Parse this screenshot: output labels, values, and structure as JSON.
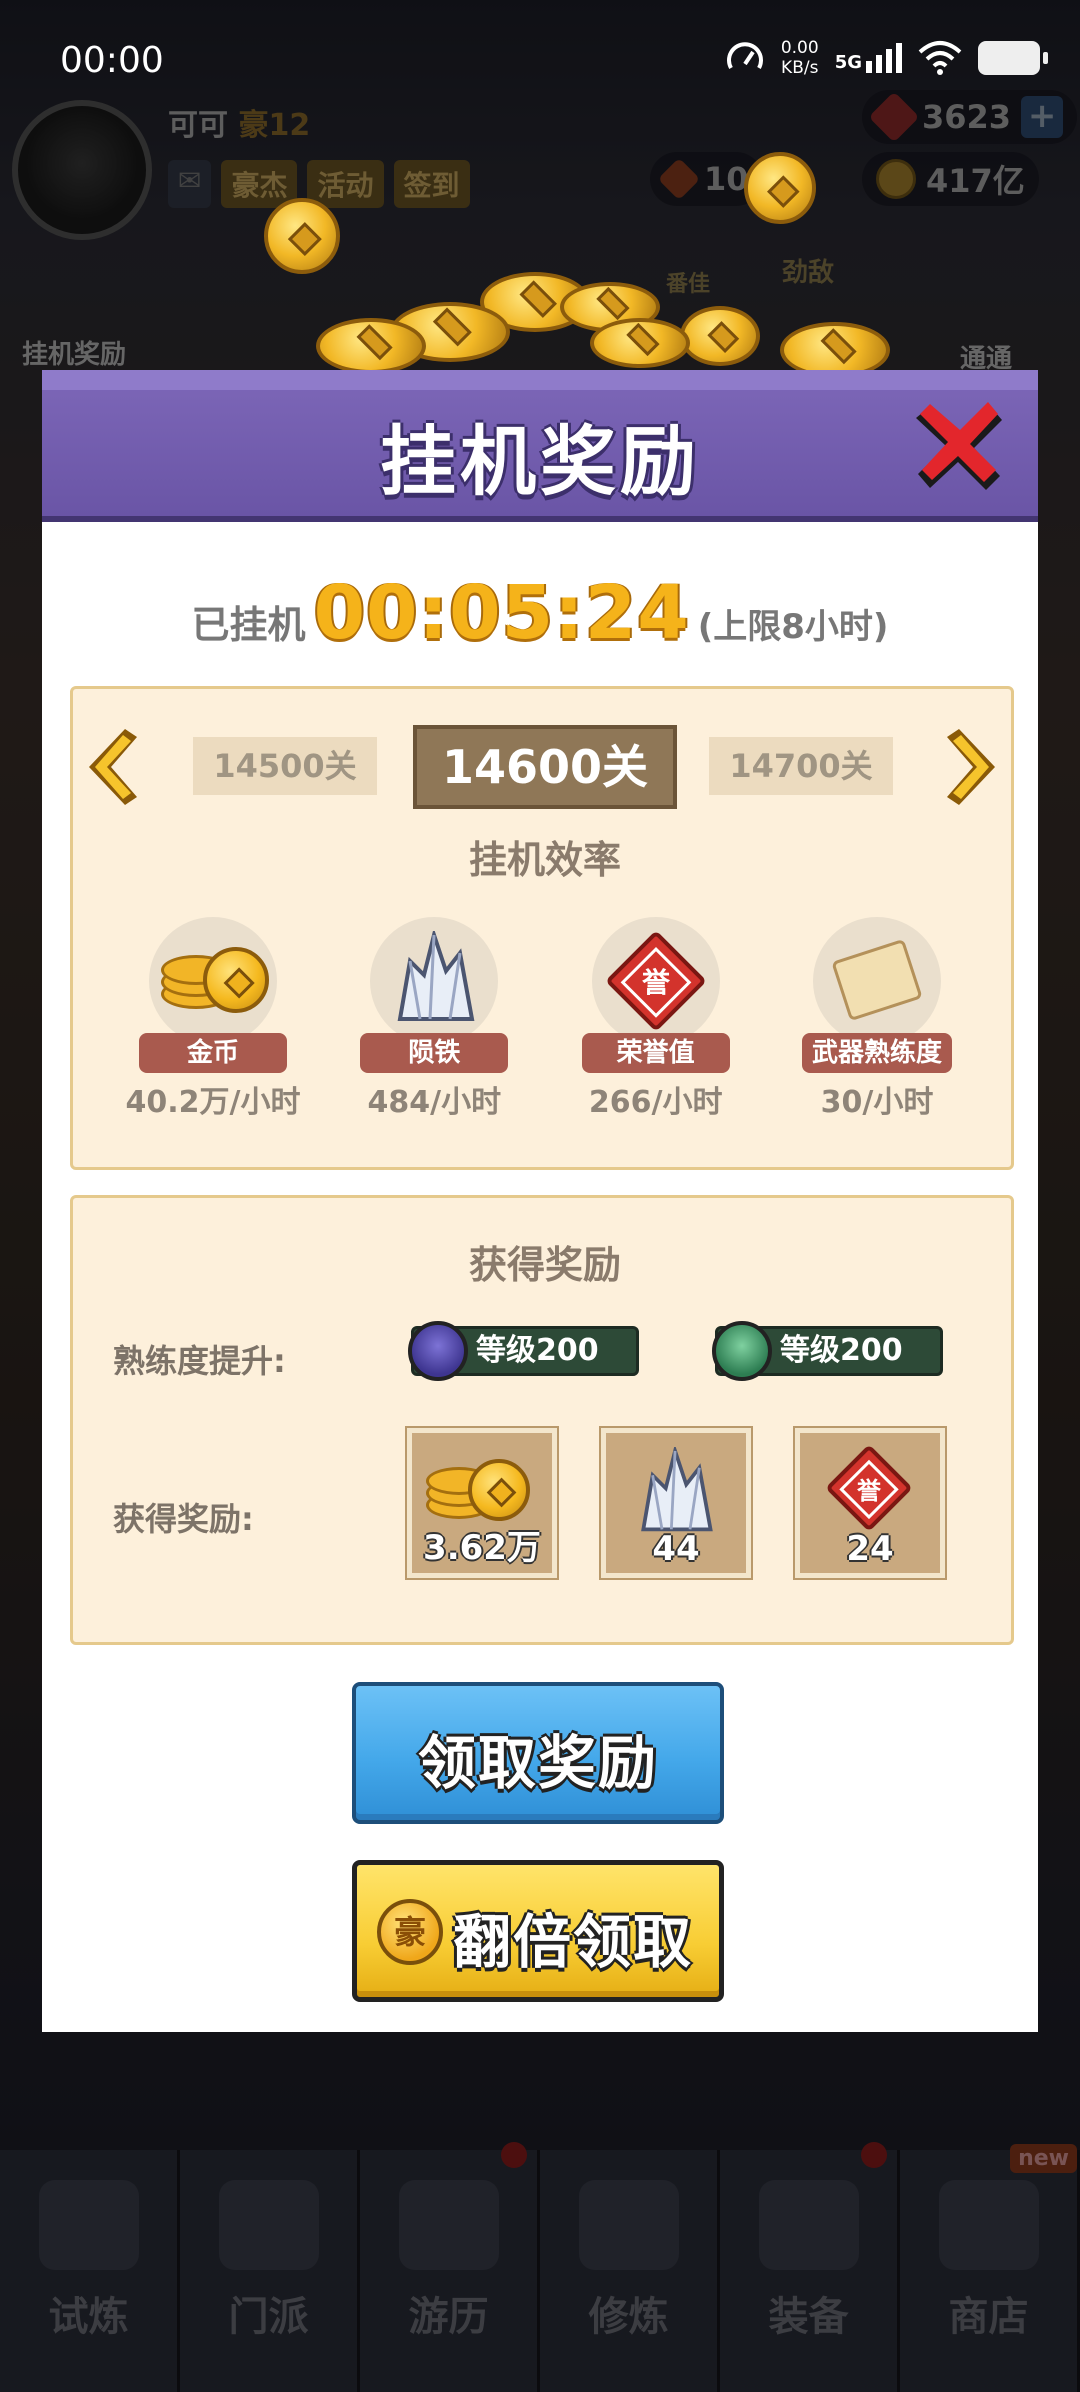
{
  "status_bar": {
    "time": "00:00",
    "speed_value": "0.00",
    "speed_unit": "KB/s",
    "network": "5G"
  },
  "background": {
    "player_name": "可可",
    "player_rank": "豪12",
    "tags": [
      "豪杰",
      "活动",
      "签到"
    ],
    "gems": "3623",
    "token_value": "10",
    "coins": "417亿",
    "left_label": "挂机奖励",
    "right_label": "通通",
    "mid_label_1": "劲敌",
    "mid_label_2": "番佳",
    "nav": [
      {
        "label": "试炼",
        "badge": false
      },
      {
        "label": "门派",
        "badge": false
      },
      {
        "label": "游历",
        "badge": true
      },
      {
        "label": "修炼",
        "badge": false
      },
      {
        "label": "装备",
        "badge": true
      },
      {
        "label": "商店",
        "badge": false,
        "new": "new"
      }
    ]
  },
  "dialog": {
    "title": "挂机奖励",
    "idle_label": "已挂机",
    "idle_time": "00:05:24",
    "idle_limit": "(上限8小时)",
    "stages": {
      "prev": "14500关",
      "current": "14600关",
      "next": "14700关"
    },
    "efficiency_title": "挂机效率",
    "efficiency": [
      {
        "name": "金币",
        "rate": "40.2万/小时",
        "icon": "gold-coin-icon"
      },
      {
        "name": "陨铁",
        "rate": "484/小时",
        "icon": "meteor-iron-icon"
      },
      {
        "name": "荣誉值",
        "rate": "266/小时",
        "icon": "honor-icon"
      },
      {
        "name": "武器熟练度",
        "rate": "30/小时",
        "icon": "scroll-icon"
      }
    ],
    "reward_title": "获得奖励",
    "proficiency_label": "熟练度提升:",
    "proficiency": [
      {
        "label": "等级200",
        "icon": "sword-icon",
        "color": "#3e3590"
      },
      {
        "label": "等级200",
        "icon": "blade-icon",
        "color": "#2d7d52"
      }
    ],
    "reward_label": "获得奖励:",
    "rewards": [
      {
        "count": "3.62万",
        "icon": "gold-coin-icon"
      },
      {
        "count": "44",
        "icon": "meteor-iron-icon"
      },
      {
        "count": "24",
        "icon": "honor-icon"
      }
    ],
    "honor_char": "誉",
    "claim_button": "领取奖励",
    "double_button": "翻倍领取",
    "double_icon_char": "豪"
  },
  "colors": {
    "header_purple": "#6a55a6",
    "timer_gold": "#f5b31a",
    "claim_blue": "#44a8ea",
    "double_yellow": "#f8cd34",
    "panel_cream": "#fdf0db"
  }
}
